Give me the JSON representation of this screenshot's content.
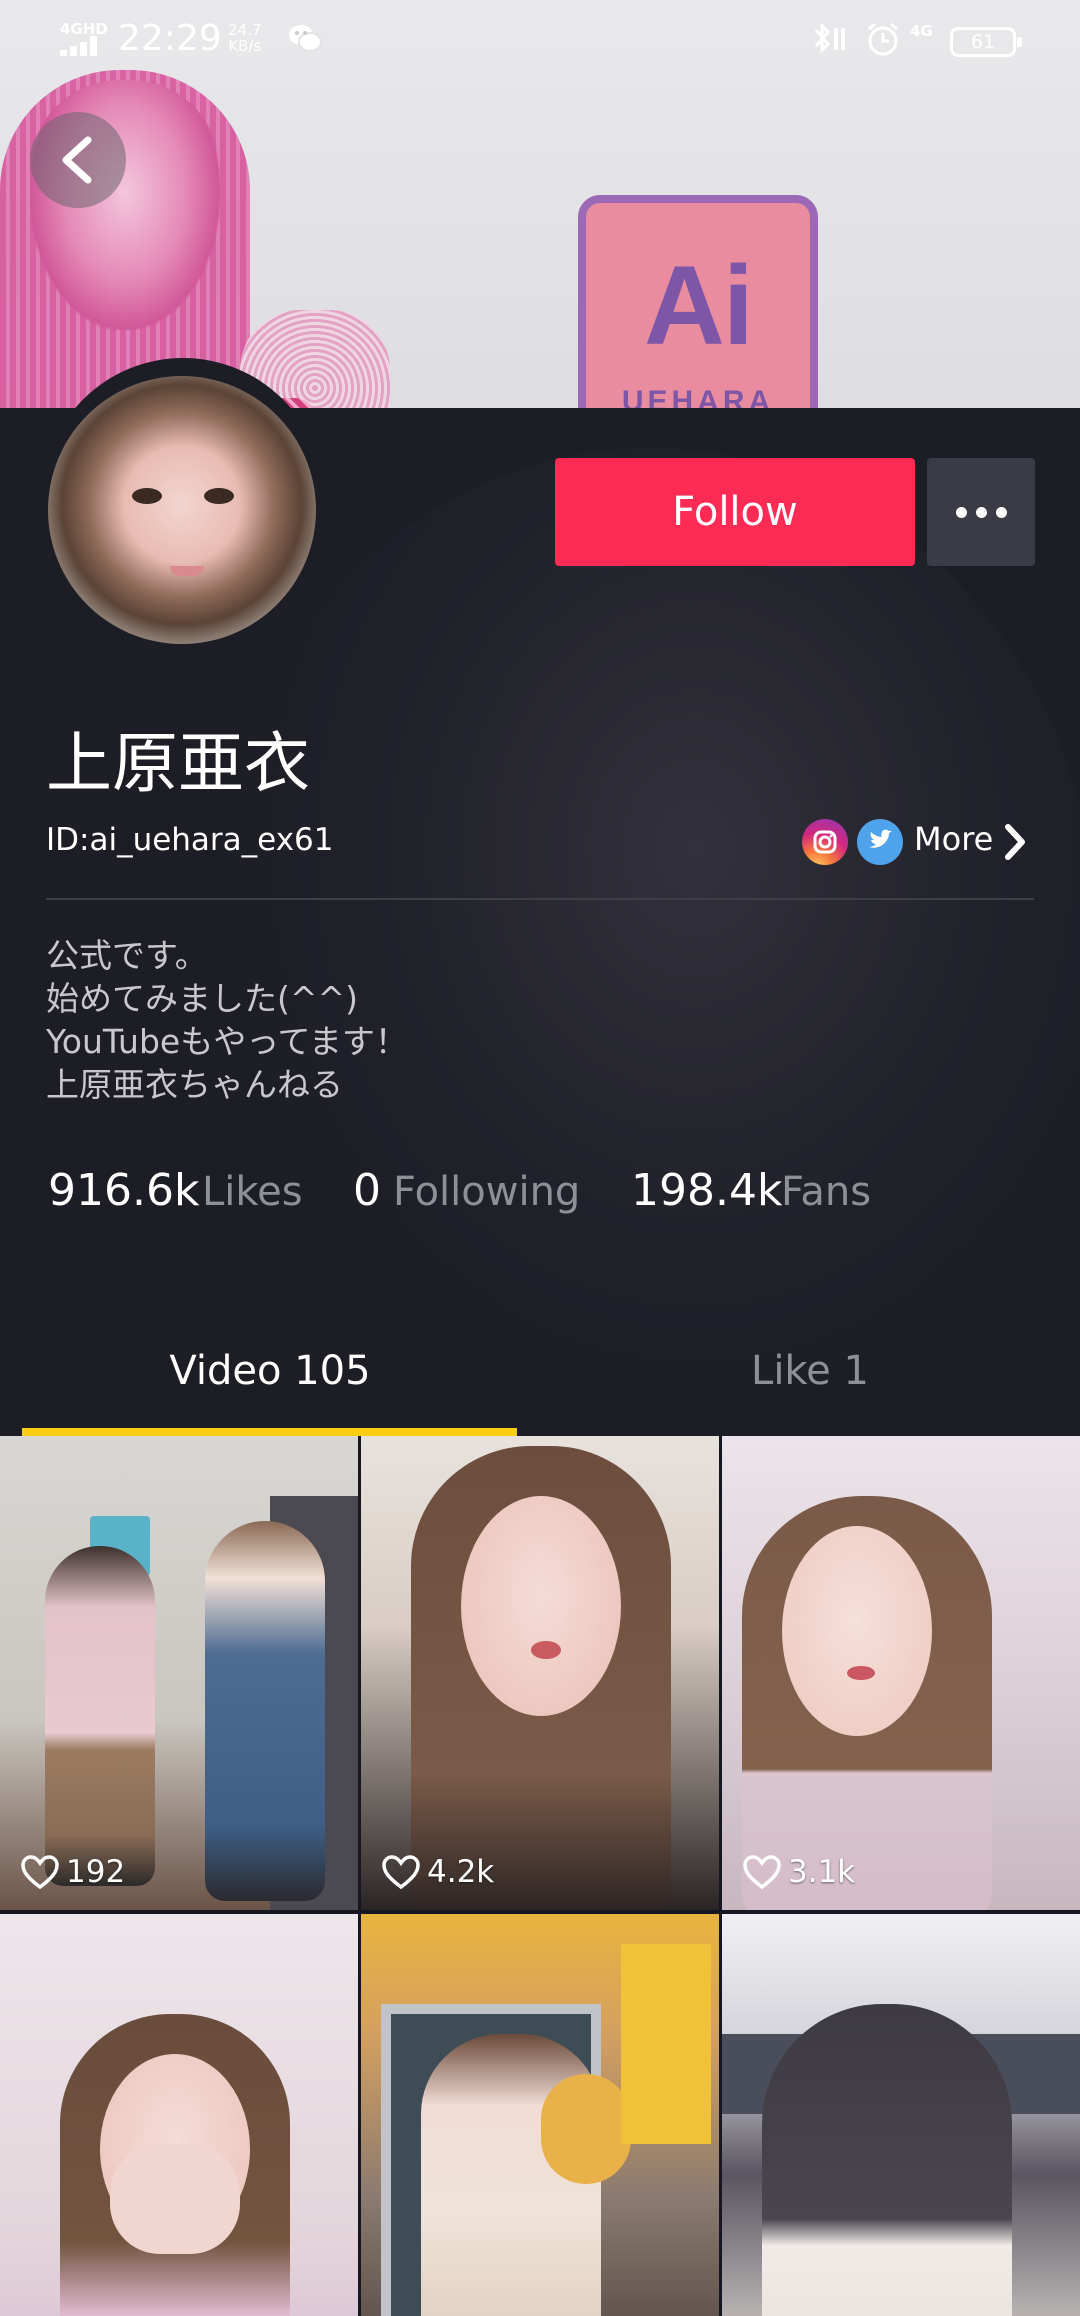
{
  "status_bar": {
    "network": "4GHD",
    "time": "22:29",
    "speed_value": "24.7",
    "speed_unit": "KB/s",
    "signal": "4G",
    "battery": "61"
  },
  "banner": {
    "badge_main": "Ai",
    "badge_sub": "UEHARA"
  },
  "profile": {
    "follow_label": "Follow",
    "name": "上原亜衣",
    "user_id": "ID:ai_uehara_ex61",
    "more_label": "More",
    "bio": [
      "公式です。",
      "始めてみました(^^)",
      "YouTubeもやってます！",
      "上原亜衣ちゃんねる"
    ]
  },
  "stats": {
    "likes_value": "916.6k",
    "likes_label": "Likes",
    "following_value": "0",
    "following_label": "Following",
    "fans_value": "198.4k",
    "fans_label": "Fans"
  },
  "tabs": {
    "video": "Video 105",
    "like": "Like 1"
  },
  "videos": [
    {
      "likes": "192"
    },
    {
      "likes": "4.2k"
    },
    {
      "likes": "3.1k"
    },
    {
      "likes": ""
    },
    {
      "likes": ""
    },
    {
      "likes": ""
    }
  ],
  "colors": {
    "follow": "#fe2c55",
    "tab_indicator": "#face15",
    "background": "#1c1d25"
  }
}
